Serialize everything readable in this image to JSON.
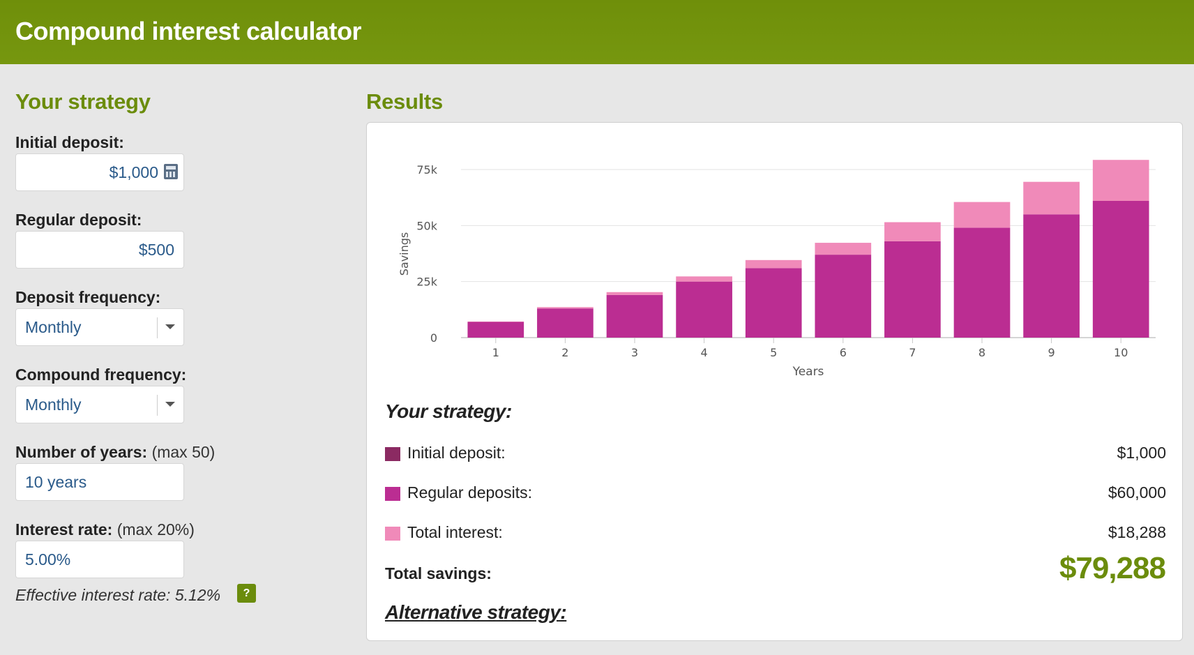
{
  "header": {
    "title": "Compound interest calculator"
  },
  "strategy_panel": {
    "title": "Your strategy",
    "initial_deposit": {
      "label": "Initial deposit:",
      "value": "$1,000"
    },
    "regular_deposit": {
      "label": "Regular deposit:",
      "value": "$500"
    },
    "deposit_frequency": {
      "label": "Deposit frequency:",
      "value": "Monthly"
    },
    "compound_frequency": {
      "label": "Compound frequency:",
      "value": "Monthly"
    },
    "years": {
      "label": "Number of years:",
      "hint": "(max 50)",
      "value": "10 years"
    },
    "interest_rate": {
      "label": "Interest rate:",
      "hint": "(max 20%)",
      "value": "5.00%"
    },
    "effective_rate": "Effective interest rate: 5.12%",
    "help_label": "?"
  },
  "results_panel": {
    "title": "Results",
    "strategy_heading": "Your strategy:",
    "legend": [
      {
        "label": "Initial deposit:",
        "value": "$1,000",
        "color": "#8b2a62"
      },
      {
        "label": "Regular deposits:",
        "value": "$60,000",
        "color": "#bb2d92"
      },
      {
        "label": "Total interest:",
        "value": "$18,288",
        "color": "#f08ab9"
      }
    ],
    "total_label": "Total savings:",
    "total_value": "$79,288",
    "alt_strategy": "Alternative strategy:"
  },
  "chart_data": {
    "type": "bar",
    "stacked": true,
    "categories": [
      "1",
      "2",
      "3",
      "4",
      "5",
      "6",
      "7",
      "8",
      "9",
      "10"
    ],
    "xlabel": "Years",
    "ylabel": "Savings",
    "ylim": [
      0,
      75000
    ],
    "yticks": [
      0,
      25000,
      50000,
      75000
    ],
    "ytick_labels": [
      "0",
      "25k",
      "50k",
      "75k"
    ],
    "series": [
      {
        "color": "#bb2d92",
        "values": [
          7000,
          13000,
          19000,
          25000,
          31000,
          37000,
          43000,
          49000,
          55000,
          61000
        ]
      },
      {
        "color": "#f08ab9",
        "values": [
          170,
          600,
          1300,
          2300,
          3600,
          5300,
          8500,
          11500,
          14500,
          18288
        ]
      }
    ],
    "grid": true,
    "legend": false
  }
}
